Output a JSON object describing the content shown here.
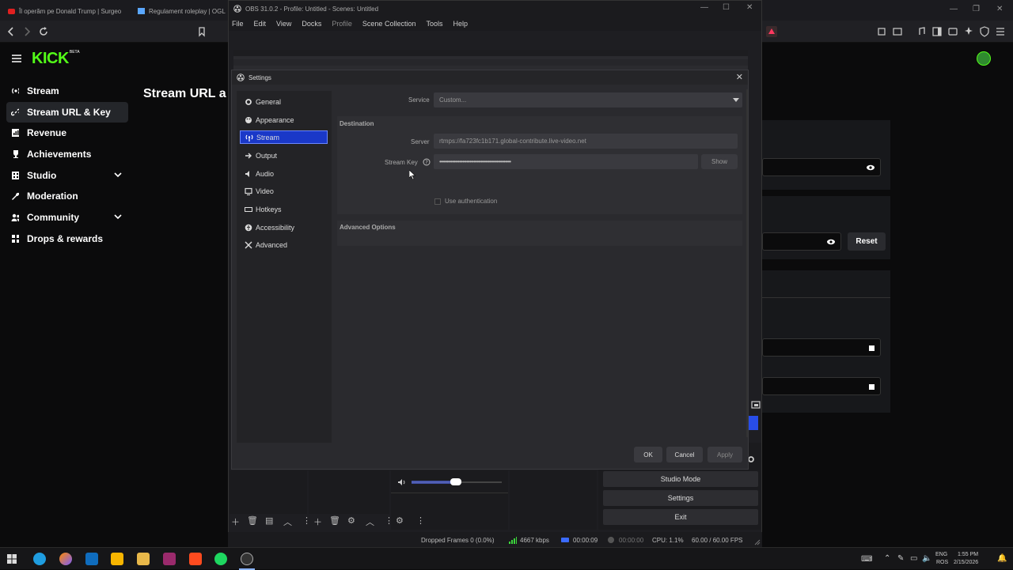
{
  "browser": {
    "tabs": [
      {
        "label": "Îl operăm pe Donald Trump | Surgeo"
      },
      {
        "label": "Regulament roleplay | OGL"
      }
    ]
  },
  "kick": {
    "logo": "KICK",
    "logo_badge": "BETA",
    "nav": [
      {
        "label": "Stream",
        "icon": "radio-icon"
      },
      {
        "label": "Stream URL & Key",
        "icon": "link-icon",
        "active": true
      },
      {
        "label": "Revenue",
        "icon": "revenue-icon"
      },
      {
        "label": "Achievements",
        "icon": "trophy-icon"
      },
      {
        "label": "Studio",
        "icon": "studio-icon",
        "expandable": true
      },
      {
        "label": "Moderation",
        "icon": "wrench-icon"
      },
      {
        "label": "Community",
        "icon": "community-icon",
        "expandable": true
      },
      {
        "label": "Drops & rewards",
        "icon": "gift-icon"
      }
    ],
    "page_title": "Stream URL a",
    "reset_label": "Reset",
    "accent_color": "#53fc18"
  },
  "obs": {
    "window_title": "OBS 31.0.2 - Profile: Untitled - Scenes: Untitled",
    "menu": [
      "File",
      "Edit",
      "View",
      "Docks",
      "Profile",
      "Scene Collection",
      "Tools",
      "Help"
    ],
    "controls": {
      "studio_mode": "Studio Mode",
      "settings": "Settings",
      "exit": "Exit"
    },
    "status": {
      "dropped_frames": "Dropped Frames 0 (0.0%)",
      "bitrate": "4667 kbps",
      "stream_time": "00:00:09",
      "record_time": "00:00:00",
      "cpu": "CPU: 1.1%",
      "fps": "60.00 / 60.00 FPS"
    }
  },
  "settings": {
    "title": "Settings",
    "nav": [
      {
        "label": "General",
        "icon": "gear-icon"
      },
      {
        "label": "Appearance",
        "icon": "palette-icon"
      },
      {
        "label": "Stream",
        "icon": "antenna-icon",
        "active": true
      },
      {
        "label": "Output",
        "icon": "output-icon"
      },
      {
        "label": "Audio",
        "icon": "speaker-icon"
      },
      {
        "label": "Video",
        "icon": "monitor-icon"
      },
      {
        "label": "Hotkeys",
        "icon": "keyboard-icon"
      },
      {
        "label": "Accessibility",
        "icon": "accessibility-icon"
      },
      {
        "label": "Advanced",
        "icon": "tools-icon"
      }
    ],
    "service_label": "Service",
    "service_value": "Custom...",
    "destination_title": "Destination",
    "server_label": "Server",
    "server_value": "rtmps://fa723fc1b171.global-contribute.live-video.net",
    "stream_key_label": "Stream Key",
    "stream_key_value": "••••••••••••••••••••••••••••••••••••••••••••••••••",
    "show_label": "Show",
    "use_auth_label": "Use authentication",
    "advanced_options_title": "Advanced Options",
    "ok_label": "OK",
    "cancel_label": "Cancel",
    "apply_label": "Apply",
    "active_color": "#1a38c8"
  },
  "taskbar": {
    "lang_top": "ENG",
    "lang_bottom": "ROS",
    "time": "1:55 PM",
    "date": "2/15/2026"
  }
}
